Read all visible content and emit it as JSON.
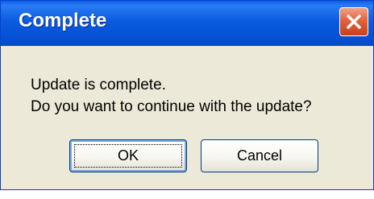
{
  "window": {
    "title": "Complete"
  },
  "message": {
    "line1": "Update is complete.",
    "line2": "Do you want to continue with the update?"
  },
  "buttons": {
    "ok_label": "OK",
    "cancel_label": "Cancel"
  },
  "icons": {
    "close": "close-icon"
  },
  "colors": {
    "titlebar": "#0b5bdf",
    "close_button": "#e1623a",
    "dialog_background": "#ece9d8"
  }
}
